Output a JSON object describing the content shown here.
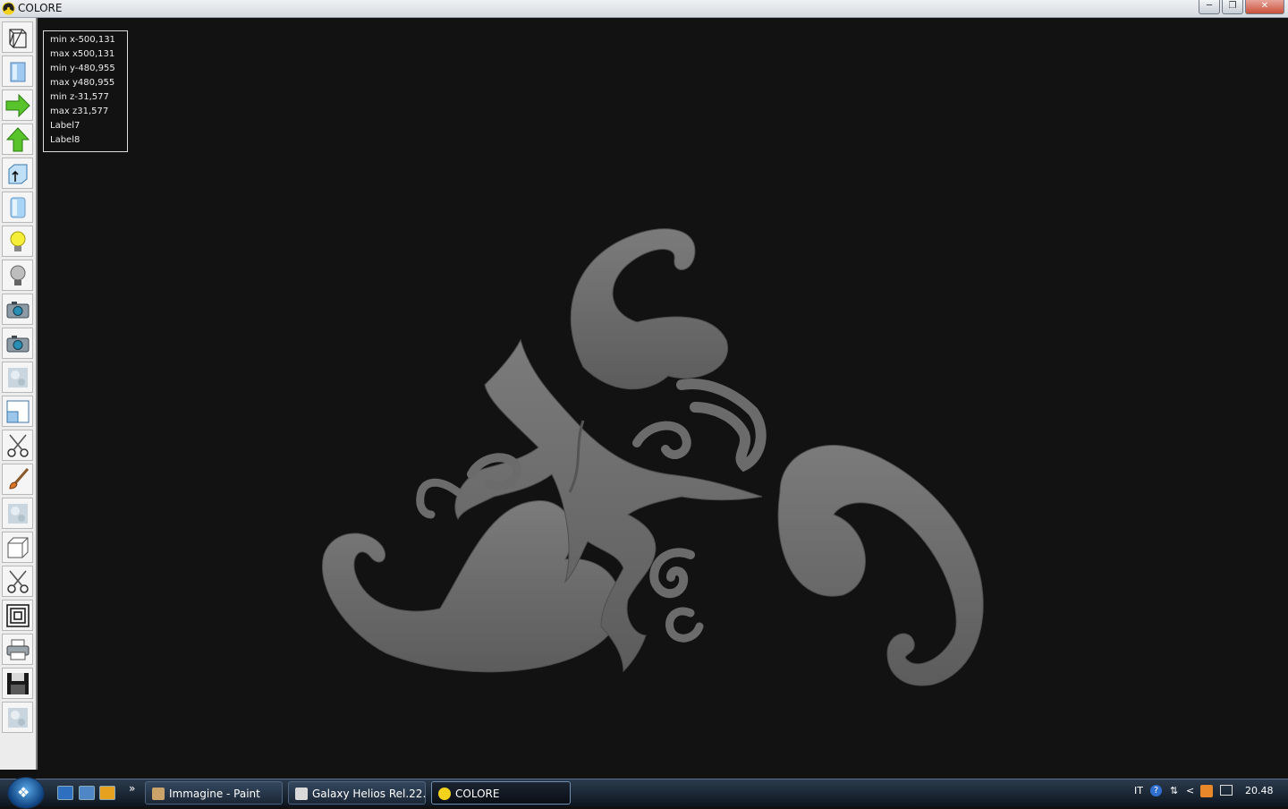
{
  "window": {
    "title": "COLORE",
    "controls": [
      "minimize",
      "maximize",
      "close"
    ]
  },
  "toolbar": {
    "tools": [
      "wireframe-icon",
      "solid-view-icon",
      "arrow-right-icon",
      "arrow-up-icon",
      "extrude-icon",
      "cylinder-icon",
      "light-on-icon",
      "light-off-icon",
      "camera-icon",
      "camera-2-icon",
      "texture-icon",
      "window-icon",
      "scissors-icon",
      "brush-icon",
      "texture-2-icon",
      "box-icon",
      "scissors-2-icon",
      "concentric-squares-icon",
      "printer-icon",
      "floppy-save-icon",
      "texture-3-icon"
    ]
  },
  "info": {
    "lines": [
      "min x-500,131",
      "max x500,131",
      "min y-480,955",
      "max y480,955",
      "min z-31,577",
      "max z31,577",
      "Label7",
      "Label8"
    ]
  },
  "taskbar": {
    "tasks": [
      "Immagine - Paint",
      "Galaxy Helios  Rel.22...",
      "COLORE"
    ],
    "active_task": "COLORE",
    "language": "IT",
    "clock": "20.48"
  },
  "colors": {
    "viewport_bg": "#121212",
    "model_gray": "#6e6e6e"
  }
}
